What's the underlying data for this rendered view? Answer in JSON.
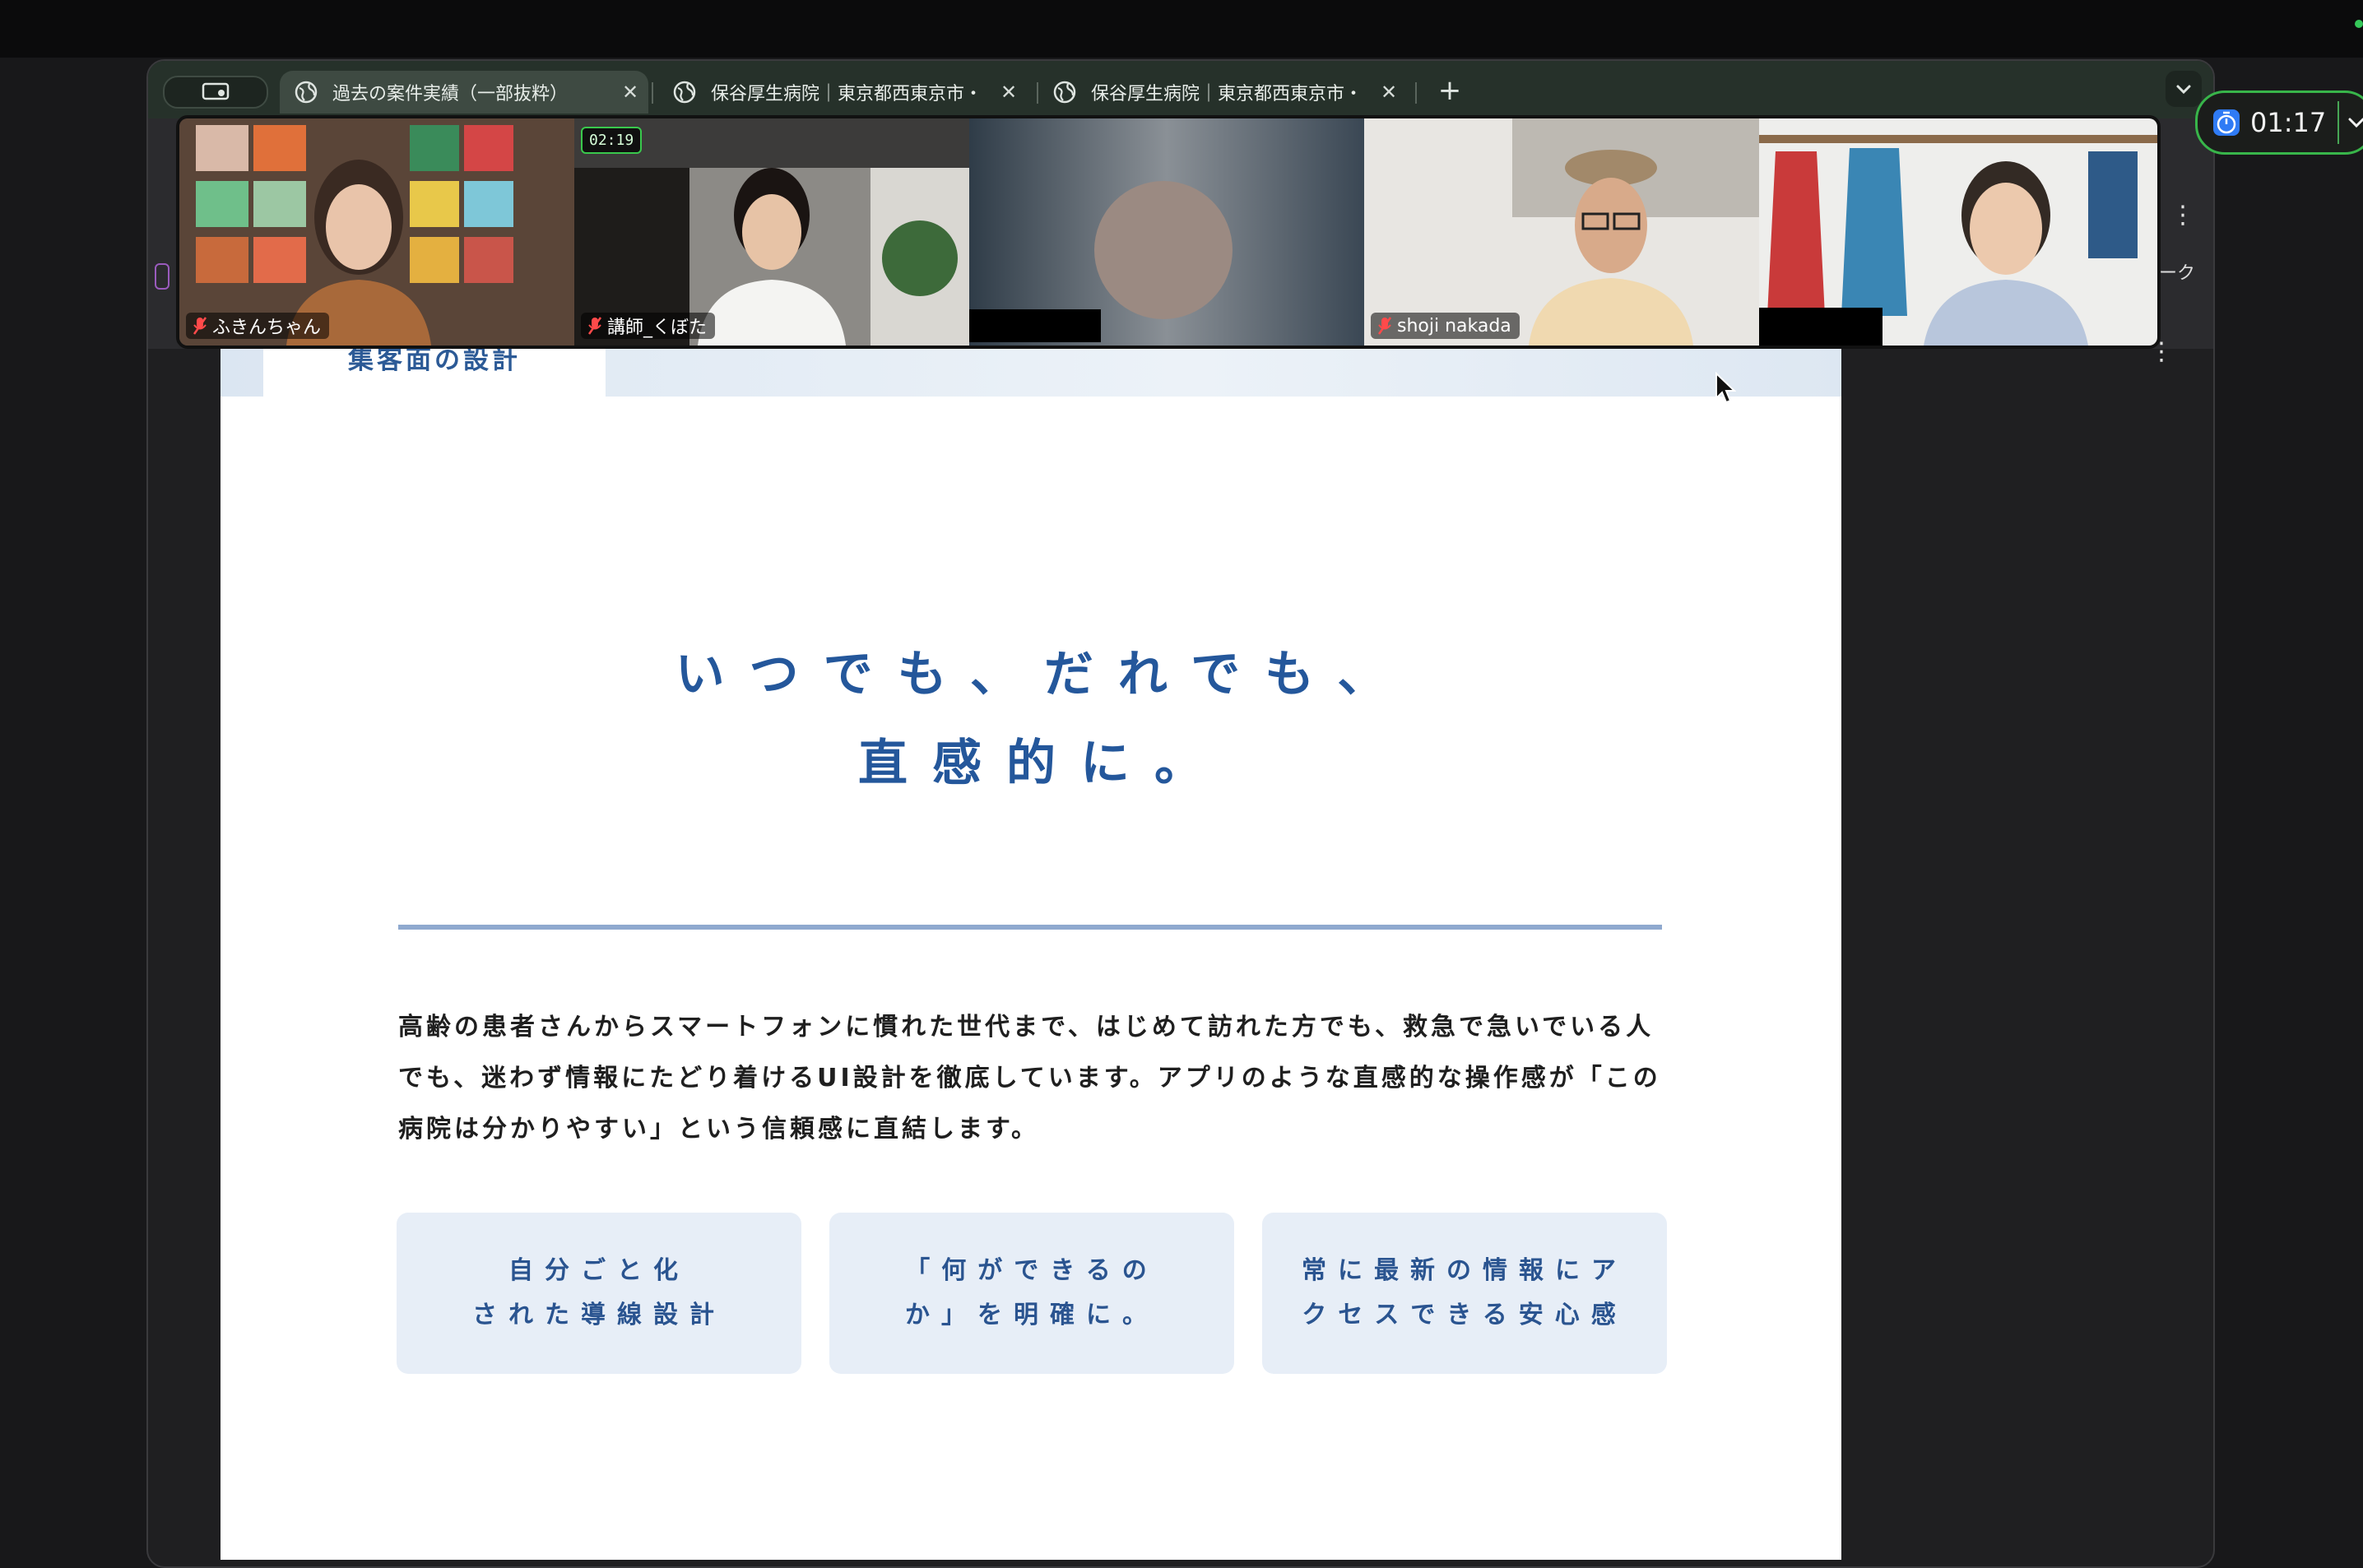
{
  "browser": {
    "tabs": [
      {
        "title": "過去の案件実績（一部抜粋）",
        "active": true
      },
      {
        "title": "保谷厚生病院｜東京都西東京市・",
        "active": false
      },
      {
        "title": "保谷厚生病院｜東京都西東京市・",
        "active": false
      }
    ],
    "new_tab_label": "+",
    "close_label": "✕",
    "right_fragment": "ーク"
  },
  "zoom": {
    "participants": [
      {
        "name": "ふきんちゃん",
        "muted": true
      },
      {
        "name": "講師_くぼた",
        "muted": true,
        "timer": "02:19"
      },
      {
        "name": "",
        "muted": false,
        "speaking": true
      },
      {
        "name": "shoji nakada",
        "muted": true
      },
      {
        "name": "",
        "muted": false
      }
    ],
    "meeting_timer": "01:17"
  },
  "site": {
    "section_tab": "集客面の設計",
    "headline_line1": "いつでも、だれでも、",
    "headline_line2": "直感的に。",
    "body_line1": "高齢の患者さんからスマートフォンに慣れた世代まで、はじめて訪れた方でも、救急で急いでいる人",
    "body_line2": "でも、迷わず情報にたどり着けるUI設計を徹底しています。アプリのような直感的な操作感が「この",
    "body_line3": "病院は分かりやすい」という信頼感に直結します。",
    "features": [
      {
        "line1": "自分ごと化",
        "line2": "された導線設計"
      },
      {
        "line1": "「何ができるの",
        "line2": "か」を明確に。"
      },
      {
        "line1": "常に最新の情報にア",
        "line2": "クセスできる安心感"
      }
    ]
  },
  "colors": {
    "accent_blue": "#24579b",
    "active_speaker": "#3ad24e",
    "tab_strip": "#26312a"
  }
}
